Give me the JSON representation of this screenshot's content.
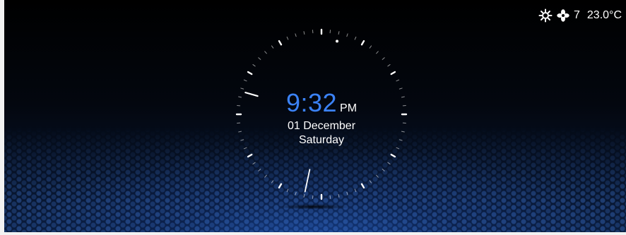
{
  "status_bar": {
    "climate_icon": "defrost-snowflake-icon",
    "fan_icon": "fan-icon",
    "fan_speed": "7",
    "temperature": "23.0°C"
  },
  "clock": {
    "time": "9:32",
    "meridiem": "PM",
    "date": "01 December",
    "day": "Saturday",
    "accent_color": "#3b82f6"
  }
}
